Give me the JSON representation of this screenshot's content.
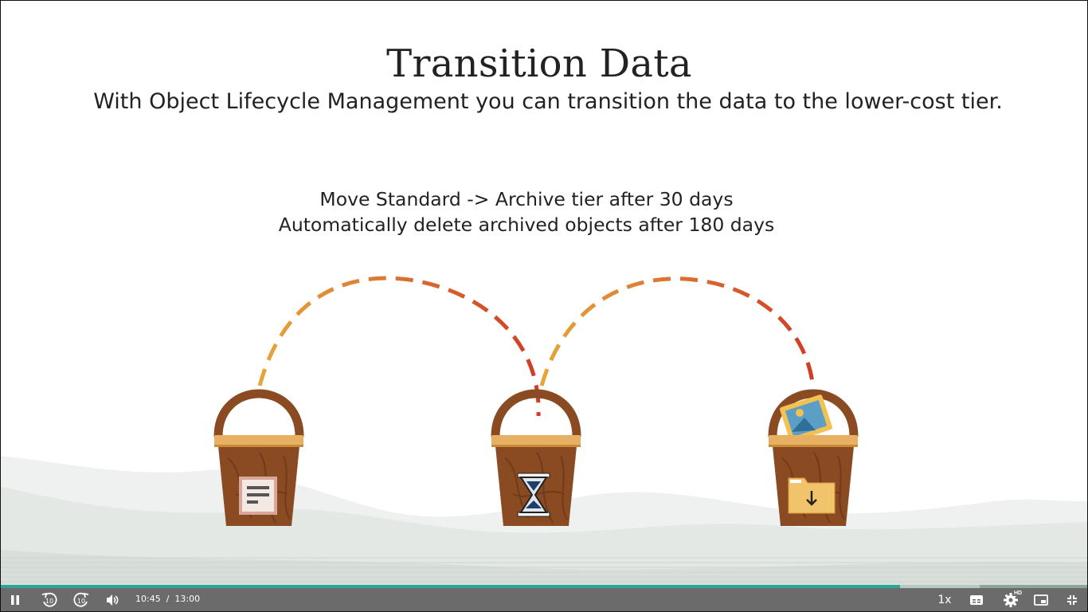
{
  "slide": {
    "title": "Transition Data",
    "subtitle": "With Object Lifecycle Management you can transition the data to the lower-cost tier.",
    "rules": [
      "Move Standard -> Archive tier after 30 days",
      "Automatically delete archived objects after 180 days"
    ],
    "buckets": [
      {
        "icon": "document-icon"
      },
      {
        "icon": "hourglass-icon"
      },
      {
        "icon": "folder-download-icon"
      }
    ],
    "colors": {
      "bucket_wood": "#8a4a22",
      "bucket_band": "#e7b062",
      "arc_start": "#e6a63a",
      "arc_end": "#cf3d26",
      "hills": "#dde3df"
    }
  },
  "player": {
    "current_time": "10:45",
    "separator": "/",
    "duration": "13:00",
    "progress": 0.827,
    "buffered": 0.9,
    "speed": "1x",
    "hd_badge": "HD",
    "icons": {
      "play_pause": "pause-icon",
      "rewind": "rewind-10-icon",
      "forward": "forward-10-icon",
      "volume": "volume-icon",
      "captions": "captions-icon",
      "settings": "gear-icon",
      "pip": "picture-in-picture-icon",
      "fullscreen": "exit-fullscreen-icon"
    },
    "colors": {
      "bar": "#6b6b6b",
      "progress": "#2aa59a"
    }
  }
}
